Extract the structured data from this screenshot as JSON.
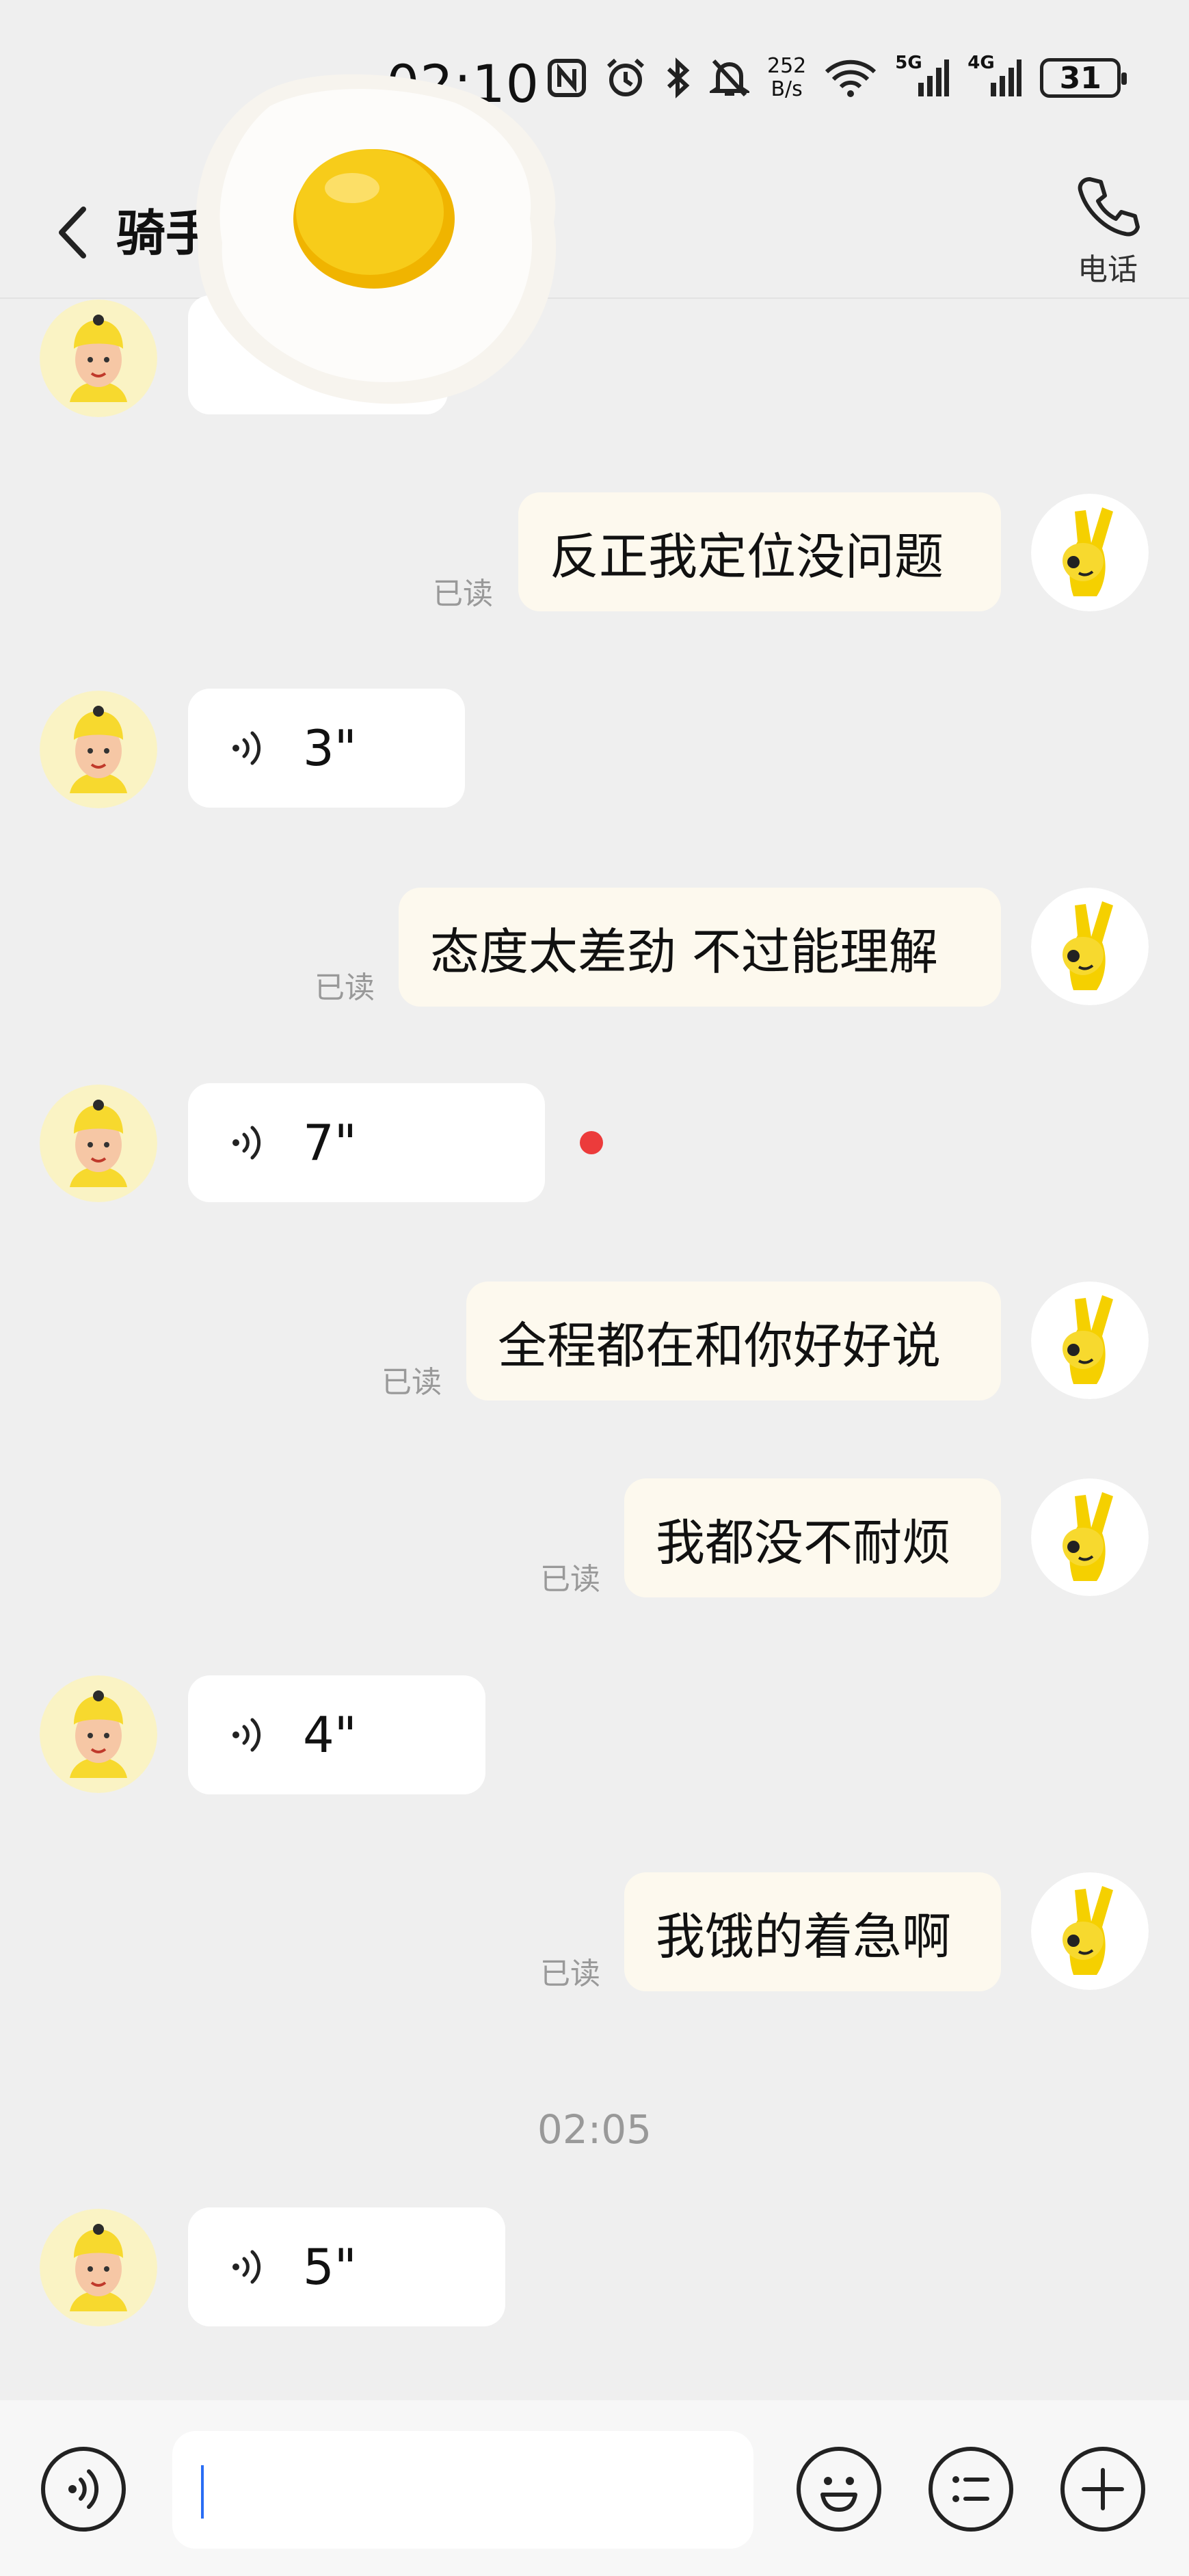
{
  "status_bar": {
    "time": "02:10",
    "speed_top": "252",
    "speed_bottom": "B/s",
    "net1": "5G",
    "net2": "4G",
    "battery": "31",
    "icons": [
      "nfc-icon",
      "alarm-icon",
      "bluetooth-icon",
      "mute-icon",
      "wifi-icon",
      "signal-icon",
      "signal-icon",
      "battery-icon"
    ]
  },
  "header": {
    "title": "骑手",
    "call_label": "电话"
  },
  "messages": [
    {
      "id": "m1",
      "type": "text",
      "direction": "out",
      "text": "反正我定位没问题",
      "read": "已读"
    },
    {
      "id": "m2",
      "type": "voice",
      "direction": "in",
      "duration": "3\""
    },
    {
      "id": "m3",
      "type": "text",
      "direction": "out",
      "text": "态度太差劲 不过能理解",
      "read": "已读"
    },
    {
      "id": "m4",
      "type": "voice",
      "direction": "in",
      "duration": "7\"",
      "unread": true
    },
    {
      "id": "m5",
      "type": "text",
      "direction": "out",
      "text": "全程都在和你好好说",
      "read": "已读"
    },
    {
      "id": "m6",
      "type": "text",
      "direction": "out",
      "text": "我都没不耐烦",
      "read": "已读"
    },
    {
      "id": "m7",
      "type": "voice",
      "direction": "in",
      "duration": "4\""
    },
    {
      "id": "m8",
      "type": "text",
      "direction": "out",
      "text": "我饿的着急啊",
      "read": "已读"
    },
    {
      "id": "m9",
      "type": "voice",
      "direction": "in",
      "duration": "5\""
    }
  ],
  "time_separator": "02:05",
  "colors": {
    "background": "#efefef",
    "outgoing_bubble": "#fdf9ee",
    "incoming_bubble": "#ffffff",
    "unread_dot": "#ec3b3b",
    "caret": "#2a6df4",
    "avatar_yellow": "#f7d92e"
  }
}
